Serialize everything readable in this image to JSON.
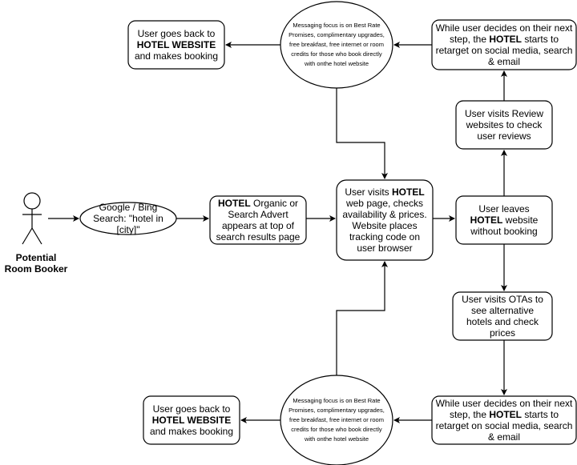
{
  "actor": {
    "label": "Potential Room Booker"
  },
  "nodes": {
    "search": [
      {
        "t": "Google / Bing Search: \"hotel in [city]\""
      }
    ],
    "advert": [
      {
        "t": "HOTEL",
        "b": true
      },
      {
        "t": " Organic or Search Advert appears at top of search results page"
      }
    ],
    "visit": [
      {
        "t": "User visits "
      },
      {
        "t": "HOTEL",
        "b": true
      },
      {
        "t": " web page, checks availability & prices. Website places tracking code on user browser"
      }
    ],
    "leaves": [
      {
        "t": "User leaves "
      },
      {
        "t": "HOTEL",
        "b": true
      },
      {
        "t": " website without booking"
      }
    ],
    "reviews": [
      {
        "t": "User visits Review websites to check user reviews"
      }
    ],
    "retarget_top": [
      {
        "t": "While user decides on their next step, the "
      },
      {
        "t": "HOTEL",
        "b": true
      },
      {
        "t": " starts to retarget on social media, search & email"
      }
    ],
    "messaging_top": [
      {
        "t": "Messaging focus is on Best Rate Promises, complimentary upgrades, free breakfast, free internet or room credits for those who book directly with onthe hotel website"
      }
    ],
    "booking_top": [
      {
        "t": "User goes back to "
      },
      {
        "t": "HOTEL WEBSITE",
        "b": true
      },
      {
        "t": " and makes booking"
      }
    ],
    "otas": [
      {
        "t": "User visits OTAs to see alternative hotels and check prices"
      }
    ],
    "retarget_bottom": [
      {
        "t": "While user decides on their next step, the "
      },
      {
        "t": "HOTEL",
        "b": true
      },
      {
        "t": " starts to retarget on social media, search & email"
      }
    ],
    "messaging_bottom": [
      {
        "t": "Messaging focus is on Best Rate Promises, complimentary upgrades, free breakfast, free internet or room credits for those who book directly with onthe hotel website"
      }
    ],
    "booking_bottom": [
      {
        "t": "User goes back to "
      },
      {
        "t": "HOTEL WEBSITE",
        "b": true
      },
      {
        "t": " and makes booking"
      }
    ]
  }
}
